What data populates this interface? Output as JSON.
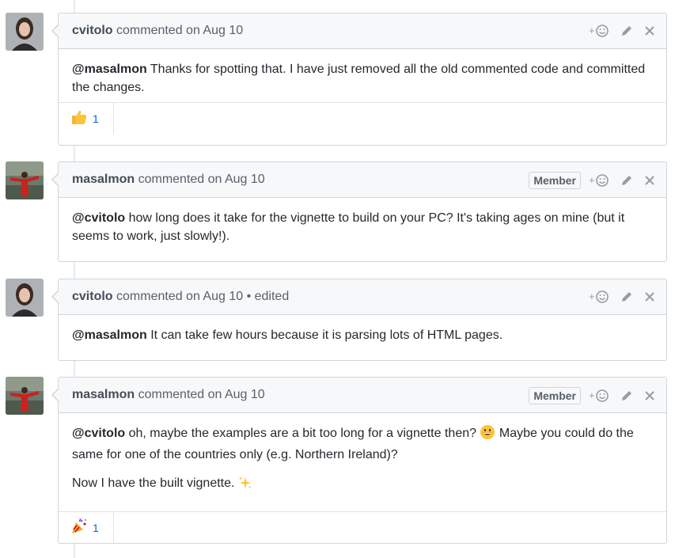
{
  "comments": [
    {
      "author": "cvitolo",
      "meta": " commented on Aug 10",
      "edited": "",
      "badge": "",
      "mention": "@masalmon",
      "text": " Thanks for spotting that. I have just removed all the old commented code and committed the changes.",
      "reaction": {
        "icon": "thumbs-up-icon",
        "count": "1"
      }
    },
    {
      "author": "masalmon",
      "meta": " commented on Aug 10",
      "edited": "",
      "badge": "Member",
      "mention": "@cvitolo",
      "text": " how long does it take for the vignette to build on your PC? It's taking ages on mine (but it seems to work, just slowly!).",
      "reaction": null
    },
    {
      "author": "cvitolo",
      "meta": " commented on Aug 10",
      "edited": " • edited",
      "badge": "",
      "mention": "@masalmon",
      "text": " It can take few hours because it is parsing lots of HTML pages.",
      "reaction": null
    },
    {
      "author": "masalmon",
      "meta": " commented on Aug 10",
      "edited": "",
      "badge": "Member",
      "mention": "@cvitolo",
      "text_before_emoji": " oh, maybe the examples are a bit too long for a vignette then? ",
      "text_after_emoji": " Maybe you could do the same for one of the countries only (e.g. Northern Ireland)?",
      "paragraph2": "Now I have the built vignette. ",
      "reaction": {
        "icon": "party-popper-icon",
        "count": "1"
      }
    }
  ],
  "actions": {
    "add_reaction": "+",
    "edit_icon": "pencil-icon",
    "delete_icon": "close-icon"
  }
}
